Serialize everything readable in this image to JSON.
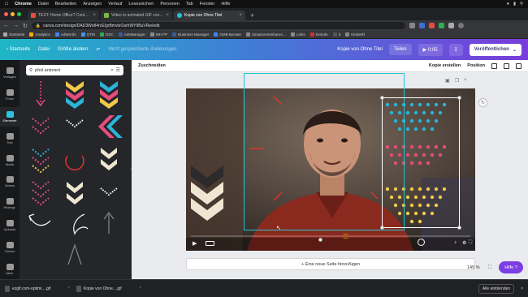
{
  "macos": {
    "app": "Chrome",
    "menus": [
      "Datei",
      "Bearbeiten",
      "Anzeigen",
      "Verlauf",
      "Lesezeichen",
      "Personen",
      "Tab",
      "Fenster",
      "Hilfe"
    ]
  },
  "tabs": [
    {
      "label": "TEST: Home Office? Content H..."
    },
    {
      "label": "Video to animated GIF converter"
    },
    {
      "label": "Kopie von Ohne Titel"
    }
  ],
  "address": {
    "url": "canva.com/design/DAD3Wo84rcE/grBmvloOarhWY9BuVRw/edit"
  },
  "bookmarks": [
    "Startseite",
    "Analytics",
    "AdWords",
    "GTM",
    "GSC",
    "AdsManager",
    "MH FP",
    "Business Manager",
    "GMB Berater",
    "Zusatzvereinbarun...",
    "Links",
    "kotmdn",
    "d",
    "Kinderkl"
  ],
  "canva": {
    "home": "Startseite",
    "file": "Datei",
    "resize": "Größe ändern",
    "unsaved": "Nicht gespeicherte Änderungen",
    "doc_title": "Kopie von Ohne Titel",
    "share": "Teilen",
    "play_time": "0:05",
    "publish": "Veröffentlichen",
    "context": {
      "crop": "Zuschneiden",
      "copy_btn": "Kopie erstellen",
      "position": "Position"
    },
    "add_page": "+ Eine neue Seite hinzufügen",
    "zoom": "145 %",
    "help": "Hilfe ?"
  },
  "rail": [
    {
      "label": "Vorlagen",
      "icon": "templates-icon"
    },
    {
      "label": "Fotos",
      "icon": "photos-icon"
    },
    {
      "label": "Elemente",
      "icon": "elements-icon"
    },
    {
      "label": "Text",
      "icon": "text-icon"
    },
    {
      "label": "Musik",
      "icon": "music-icon"
    },
    {
      "label": "Videos",
      "icon": "video-icon"
    },
    {
      "label": "Hintergr.",
      "icon": "background-icon"
    },
    {
      "label": "Uploads",
      "icon": "uploads-icon"
    },
    {
      "label": "Ordner",
      "icon": "folder-icon"
    },
    {
      "label": "Mehr",
      "icon": "more-icon"
    }
  ],
  "panel": {
    "search_value": "pfeil animiert"
  },
  "downloads": [
    {
      "name": "ezgif.com-optimi....gif"
    },
    {
      "name": "Kopie von Ohne....gif"
    }
  ],
  "downloads_show_all": "Alle einblenden",
  "colors": {
    "accent_teal": "#21c5d5",
    "accent_purple": "#7b3fe4",
    "chevron_yellow": "#f2c84b",
    "chevron_pink": "#e64c7c",
    "chevron_blue": "#2cb3d8"
  }
}
